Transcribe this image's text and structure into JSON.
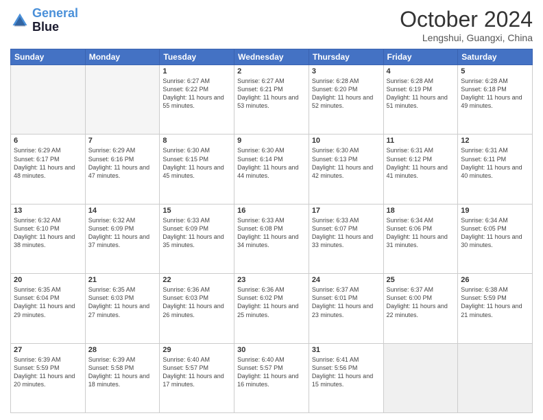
{
  "header": {
    "logo_line1": "General",
    "logo_line2": "Blue",
    "title": "October 2024",
    "location": "Lengshui, Guangxi, China"
  },
  "weekdays": [
    "Sunday",
    "Monday",
    "Tuesday",
    "Wednesday",
    "Thursday",
    "Friday",
    "Saturday"
  ],
  "weeks": [
    [
      {
        "day": "",
        "empty": true
      },
      {
        "day": "",
        "empty": true
      },
      {
        "day": "1",
        "sunrise": "6:27 AM",
        "sunset": "6:22 PM",
        "daylight": "11 hours and 55 minutes."
      },
      {
        "day": "2",
        "sunrise": "6:27 AM",
        "sunset": "6:21 PM",
        "daylight": "11 hours and 53 minutes."
      },
      {
        "day": "3",
        "sunrise": "6:28 AM",
        "sunset": "6:20 PM",
        "daylight": "11 hours and 52 minutes."
      },
      {
        "day": "4",
        "sunrise": "6:28 AM",
        "sunset": "6:19 PM",
        "daylight": "11 hours and 51 minutes."
      },
      {
        "day": "5",
        "sunrise": "6:28 AM",
        "sunset": "6:18 PM",
        "daylight": "11 hours and 49 minutes."
      }
    ],
    [
      {
        "day": "6",
        "sunrise": "6:29 AM",
        "sunset": "6:17 PM",
        "daylight": "11 hours and 48 minutes."
      },
      {
        "day": "7",
        "sunrise": "6:29 AM",
        "sunset": "6:16 PM",
        "daylight": "11 hours and 47 minutes."
      },
      {
        "day": "8",
        "sunrise": "6:30 AM",
        "sunset": "6:15 PM",
        "daylight": "11 hours and 45 minutes."
      },
      {
        "day": "9",
        "sunrise": "6:30 AM",
        "sunset": "6:14 PM",
        "daylight": "11 hours and 44 minutes."
      },
      {
        "day": "10",
        "sunrise": "6:30 AM",
        "sunset": "6:13 PM",
        "daylight": "11 hours and 42 minutes."
      },
      {
        "day": "11",
        "sunrise": "6:31 AM",
        "sunset": "6:12 PM",
        "daylight": "11 hours and 41 minutes."
      },
      {
        "day": "12",
        "sunrise": "6:31 AM",
        "sunset": "6:11 PM",
        "daylight": "11 hours and 40 minutes."
      }
    ],
    [
      {
        "day": "13",
        "sunrise": "6:32 AM",
        "sunset": "6:10 PM",
        "daylight": "11 hours and 38 minutes."
      },
      {
        "day": "14",
        "sunrise": "6:32 AM",
        "sunset": "6:09 PM",
        "daylight": "11 hours and 37 minutes."
      },
      {
        "day": "15",
        "sunrise": "6:33 AM",
        "sunset": "6:09 PM",
        "daylight": "11 hours and 35 minutes."
      },
      {
        "day": "16",
        "sunrise": "6:33 AM",
        "sunset": "6:08 PM",
        "daylight": "11 hours and 34 minutes."
      },
      {
        "day": "17",
        "sunrise": "6:33 AM",
        "sunset": "6:07 PM",
        "daylight": "11 hours and 33 minutes."
      },
      {
        "day": "18",
        "sunrise": "6:34 AM",
        "sunset": "6:06 PM",
        "daylight": "11 hours and 31 minutes."
      },
      {
        "day": "19",
        "sunrise": "6:34 AM",
        "sunset": "6:05 PM",
        "daylight": "11 hours and 30 minutes."
      }
    ],
    [
      {
        "day": "20",
        "sunrise": "6:35 AM",
        "sunset": "6:04 PM",
        "daylight": "11 hours and 29 minutes."
      },
      {
        "day": "21",
        "sunrise": "6:35 AM",
        "sunset": "6:03 PM",
        "daylight": "11 hours and 27 minutes."
      },
      {
        "day": "22",
        "sunrise": "6:36 AM",
        "sunset": "6:03 PM",
        "daylight": "11 hours and 26 minutes."
      },
      {
        "day": "23",
        "sunrise": "6:36 AM",
        "sunset": "6:02 PM",
        "daylight": "11 hours and 25 minutes."
      },
      {
        "day": "24",
        "sunrise": "6:37 AM",
        "sunset": "6:01 PM",
        "daylight": "11 hours and 23 minutes."
      },
      {
        "day": "25",
        "sunrise": "6:37 AM",
        "sunset": "6:00 PM",
        "daylight": "11 hours and 22 minutes."
      },
      {
        "day": "26",
        "sunrise": "6:38 AM",
        "sunset": "5:59 PM",
        "daylight": "11 hours and 21 minutes."
      }
    ],
    [
      {
        "day": "27",
        "sunrise": "6:39 AM",
        "sunset": "5:59 PM",
        "daylight": "11 hours and 20 minutes."
      },
      {
        "day": "28",
        "sunrise": "6:39 AM",
        "sunset": "5:58 PM",
        "daylight": "11 hours and 18 minutes."
      },
      {
        "day": "29",
        "sunrise": "6:40 AM",
        "sunset": "5:57 PM",
        "daylight": "11 hours and 17 minutes."
      },
      {
        "day": "30",
        "sunrise": "6:40 AM",
        "sunset": "5:57 PM",
        "daylight": "11 hours and 16 minutes."
      },
      {
        "day": "31",
        "sunrise": "6:41 AM",
        "sunset": "5:56 PM",
        "daylight": "11 hours and 15 minutes."
      },
      {
        "day": "",
        "empty": true
      },
      {
        "day": "",
        "empty": true
      }
    ]
  ]
}
